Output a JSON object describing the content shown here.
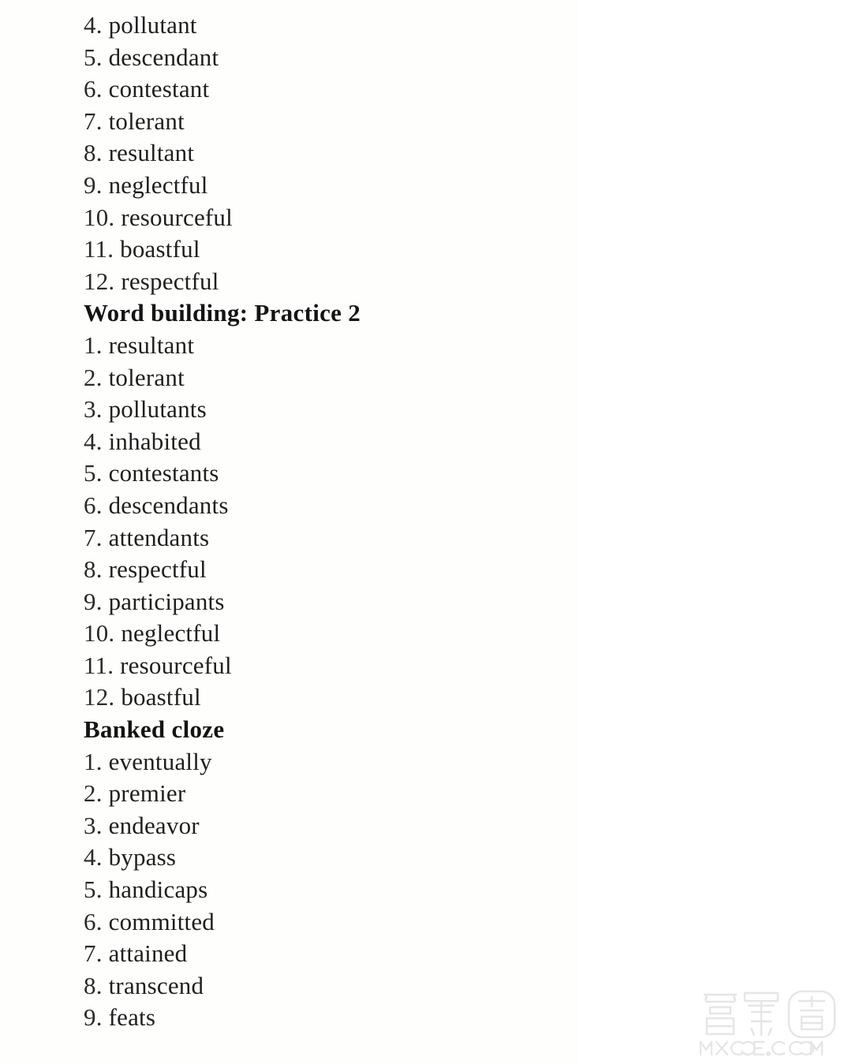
{
  "document": {
    "background_color": "#ffffff",
    "text_color": "#252525"
  },
  "sections": [
    {
      "heading": null,
      "items": [
        {
          "num": "4.",
          "word": "pollutant"
        },
        {
          "num": "5.",
          "word": "descendant"
        },
        {
          "num": "6.",
          "word": "contestant"
        },
        {
          "num": "7.",
          "word": "tolerant"
        },
        {
          "num": "8.",
          "word": "resultant"
        },
        {
          "num": "9.",
          "word": "neglectful"
        },
        {
          "num": "10.",
          "word": "resourceful"
        },
        {
          "num": "11.",
          "word": "boastful"
        },
        {
          "num": "12.",
          "word": "respectful"
        }
      ]
    },
    {
      "heading": "Word building: Practice 2",
      "items": [
        {
          "num": "1.",
          "word": "resultant"
        },
        {
          "num": "2.",
          "word": "tolerant"
        },
        {
          "num": "3.",
          "word": "pollutants"
        },
        {
          "num": "4.",
          "word": "inhabited"
        },
        {
          "num": "5.",
          "word": "contestants"
        },
        {
          "num": "6.",
          "word": "descendants"
        },
        {
          "num": "7.",
          "word": "attendants"
        },
        {
          "num": "8.",
          "word": "respectful"
        },
        {
          "num": "9.",
          "word": "participants"
        },
        {
          "num": "10.",
          "word": "neglectful"
        },
        {
          "num": "11.",
          "word": "resourceful"
        },
        {
          "num": "12.",
          "word": "boastful"
        }
      ]
    },
    {
      "heading": "Banked cloze",
      "items": [
        {
          "num": "1.",
          "word": "eventually"
        },
        {
          "num": "2.",
          "word": "premier"
        },
        {
          "num": "3.",
          "word": "endeavor"
        },
        {
          "num": "4.",
          "word": "bypass"
        },
        {
          "num": "5.",
          "word": "handicaps"
        },
        {
          "num": "6.",
          "word": "committed"
        },
        {
          "num": "7.",
          "word": "attained"
        },
        {
          "num": "8.",
          "word": "transcend"
        },
        {
          "num": "9.",
          "word": "feats"
        }
      ]
    }
  ],
  "watermark": {
    "characters": "答案卷",
    "domain_text": "MXQE.COM",
    "color": "#e8e8e8"
  }
}
